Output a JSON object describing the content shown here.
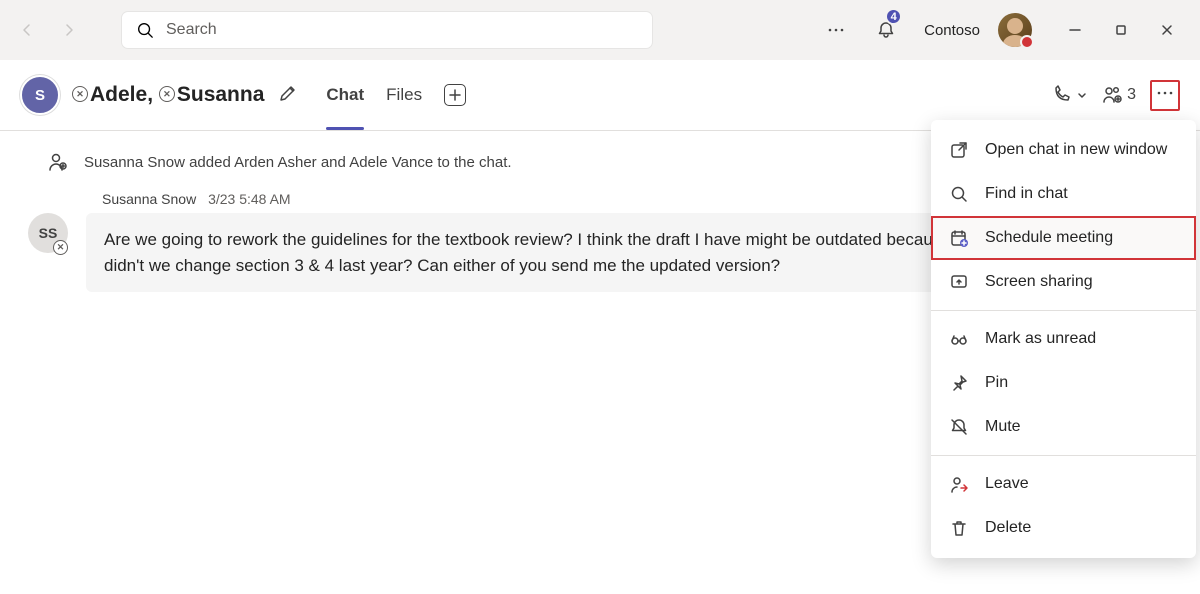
{
  "search": {
    "placeholder": "Search"
  },
  "notifications": {
    "count": "4"
  },
  "org": {
    "name": "Contoso"
  },
  "chat": {
    "avatar_initial": "S",
    "name1": "Adele",
    "name2": "Susanna",
    "tabs": {
      "chat": "Chat",
      "files": "Files"
    },
    "participants": "3"
  },
  "system_message": "Susanna Snow added Arden Asher and Adele Vance to the chat.",
  "message": {
    "author_initials": "SS",
    "author": "Susanna Snow",
    "timestamp": "3/23 5:48 AM",
    "body": "Are we going to rework the guidelines for the textbook review? I think the draft I have might be outdated because didn't we change section 3 & 4 last year? Can either of you send me the updated version?"
  },
  "menu": {
    "open_new_window": "Open chat in new window",
    "find": "Find in chat",
    "schedule": "Schedule meeting",
    "screen_share": "Screen sharing",
    "mark_unread": "Mark as unread",
    "pin": "Pin",
    "mute": "Mute",
    "leave": "Leave",
    "delete": "Delete"
  }
}
